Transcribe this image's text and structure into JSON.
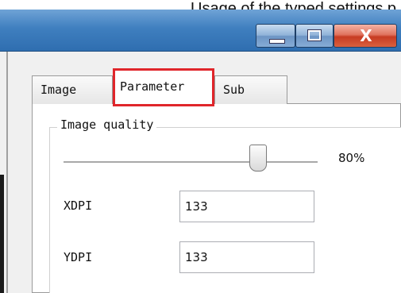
{
  "caption": "Usage of the typed settings p",
  "window": {
    "minimize_glyph": "",
    "maximize_glyph": "",
    "close_glyph": "X"
  },
  "tabs": [
    {
      "label": "Image"
    },
    {
      "label": "Parameter"
    },
    {
      "label": "Sub"
    }
  ],
  "group": {
    "title": "Image quality",
    "slider_value": "80%",
    "slider_fraction": 0.8
  },
  "fields": {
    "xdpi": {
      "label": "XDPI",
      "value": "133"
    },
    "ydpi": {
      "label": "YDPI",
      "value": "133"
    }
  },
  "colors": {
    "highlight": "#e0262b",
    "titlebar": "#3f7fbf",
    "close": "#c73b22"
  }
}
